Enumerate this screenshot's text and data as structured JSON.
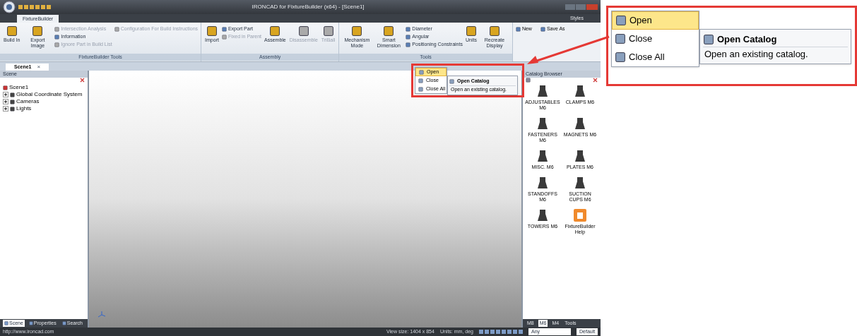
{
  "window": {
    "title": "IRONCAD for FixtureBuilder (x64) - [Scene1]",
    "styles_label": "Styles"
  },
  "ribbon_tabs": [
    {
      "label": "FixtureBuilder",
      "selected": true
    }
  ],
  "groups": [
    {
      "title": "FixtureBuilder Tools",
      "items": [
        {
          "kind": "large",
          "label": "Build In",
          "disabled": false
        },
        {
          "kind": "large",
          "label": "Export Image",
          "disabled": false
        },
        {
          "kind": "stack",
          "items": [
            {
              "label": "Intersection Analysis",
              "disabled": true
            },
            {
              "label": "Information",
              "disabled": false
            },
            {
              "label": "Ignore Part in Build List",
              "disabled": true
            }
          ]
        },
        {
          "kind": "stack",
          "items": [
            {
              "label": "Configuration For Build Instructions",
              "disabled": true
            }
          ]
        }
      ]
    },
    {
      "title": "Assembly",
      "items": [
        {
          "kind": "large",
          "label": "Import",
          "disabled": false
        },
        {
          "kind": "stack",
          "items": [
            {
              "label": "Export Part",
              "disabled": false
            },
            {
              "label": "Fixed in Parent",
              "disabled": true
            }
          ]
        },
        {
          "kind": "large",
          "label": "Assemble",
          "disabled": false
        },
        {
          "kind": "large",
          "label": "Disassemble",
          "disabled": true
        },
        {
          "kind": "large",
          "label": "TriBall",
          "disabled": true
        }
      ]
    },
    {
      "title": "Tools",
      "items": [
        {
          "kind": "large",
          "label": "Mechanism Mode",
          "disabled": false
        },
        {
          "kind": "large",
          "label": "Smart Dimension",
          "disabled": false
        },
        {
          "kind": "stack",
          "items": [
            {
              "label": "Diameter",
              "disabled": false
            },
            {
              "label": "Angular",
              "disabled": false
            },
            {
              "label": "Positioning Constraints",
              "disabled": false
            }
          ]
        },
        {
          "kind": "large",
          "label": "Units",
          "disabled": false
        },
        {
          "kind": "large",
          "label": "Recreate Display",
          "disabled": false
        }
      ]
    }
  ],
  "file_group": [
    {
      "label": "New"
    },
    {
      "label": "Save As"
    }
  ],
  "file_menu": {
    "items": [
      {
        "label": "Open",
        "selected": true
      },
      {
        "label": "Close",
        "selected": false
      },
      {
        "label": "Close All",
        "selected": false
      }
    ],
    "submenu": {
      "title": "Open Catalog",
      "description": "Open an existing catalog."
    }
  },
  "doc_tabs": [
    {
      "label": "Scene1",
      "selected": true,
      "close_glyph": "×"
    }
  ],
  "scene_panel": {
    "title": "Scene",
    "tree": [
      {
        "label": "Scene1",
        "children": [
          {
            "label": "Global Coordinate System",
            "expanded": false
          },
          {
            "label": "Cameras",
            "expanded": false
          },
          {
            "label": "Lights",
            "expanded": false
          }
        ]
      }
    ]
  },
  "panel_tabs": [
    {
      "label": "Scene",
      "selected": true
    },
    {
      "label": "Properties",
      "selected": false
    },
    {
      "label": "Search",
      "selected": false
    }
  ],
  "catalog": {
    "title": "Catalog Browser",
    "items": [
      {
        "label": "ADJUSTABLES M6",
        "kind": "part"
      },
      {
        "label": "CLAMPS M6",
        "kind": "part"
      },
      {
        "label": "FASTENERS M6",
        "kind": "part"
      },
      {
        "label": "MAGNETS M6",
        "kind": "part"
      },
      {
        "label": "MISC. M6",
        "kind": "part"
      },
      {
        "label": "PLATES M6",
        "kind": "part"
      },
      {
        "label": "STANDOFFS M6",
        "kind": "part"
      },
      {
        "label": "SUCTION CUPS M6",
        "kind": "part"
      },
      {
        "label": "TOWERS M6",
        "kind": "part"
      },
      {
        "label": "FixtureBuilder Help",
        "kind": "help"
      }
    ],
    "tabs": [
      {
        "label": "M8",
        "selected": false
      },
      {
        "label": "M6",
        "selected": true
      },
      {
        "label": "M4",
        "selected": false
      },
      {
        "label": "Tools",
        "selected": false
      }
    ]
  },
  "status_bar": {
    "url": "http://www.ironcad.com",
    "view_size": "View size: 1404 x 854",
    "units": "Units: mm, deg",
    "filter": "Any",
    "style": "Default"
  },
  "callout": {
    "items": [
      {
        "label": "Open",
        "selected": true
      },
      {
        "label": "Close",
        "selected": false
      },
      {
        "label": "Close All",
        "selected": false
      }
    ],
    "submenu": {
      "title": "Open Catalog",
      "description": "Open an existing catalog."
    }
  }
}
